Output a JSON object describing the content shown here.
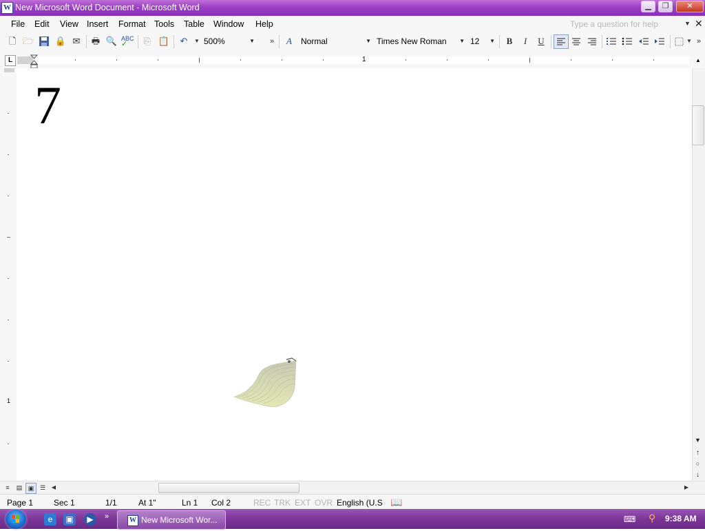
{
  "window": {
    "title": "New Microsoft Word Document - Microsoft Word",
    "app_icon": "word-icon",
    "controls": [
      "minimize-icon",
      "restore-icon",
      "close-icon"
    ]
  },
  "menubar": {
    "items": [
      {
        "label": "File"
      },
      {
        "label": "Edit"
      },
      {
        "label": "View"
      },
      {
        "label": "Insert"
      },
      {
        "label": "Format"
      },
      {
        "label": "Tools"
      },
      {
        "label": "Table"
      },
      {
        "label": "Window"
      },
      {
        "label": "Help"
      }
    ],
    "help_placeholder": "Type a question for help"
  },
  "toolbar": {
    "zoom": "500%",
    "style": "Normal",
    "font": "Times New Roman",
    "size": "12",
    "bold": "B",
    "italic": "I",
    "underline": "U",
    "align_active": "left"
  },
  "ruler": {
    "numbers": [
      "1",
      "1"
    ],
    "vertical_number": "1"
  },
  "document": {
    "text": "7"
  },
  "statusbar": {
    "page": "Page 1",
    "sec": "Sec 1",
    "pages": "1/1",
    "at": "At 1\"",
    "ln": "Ln 1",
    "col": "Col 2",
    "rec": "REC",
    "trk": "TRK",
    "ext": "EXT",
    "ovr": "OVR",
    "language": "English (U.S"
  },
  "taskbar": {
    "active_window": "New Microsoft Wor...",
    "clock": "9:38 AM"
  },
  "colors": {
    "titlebar": "#9c3fc6",
    "taskbar": "#7a3597"
  }
}
